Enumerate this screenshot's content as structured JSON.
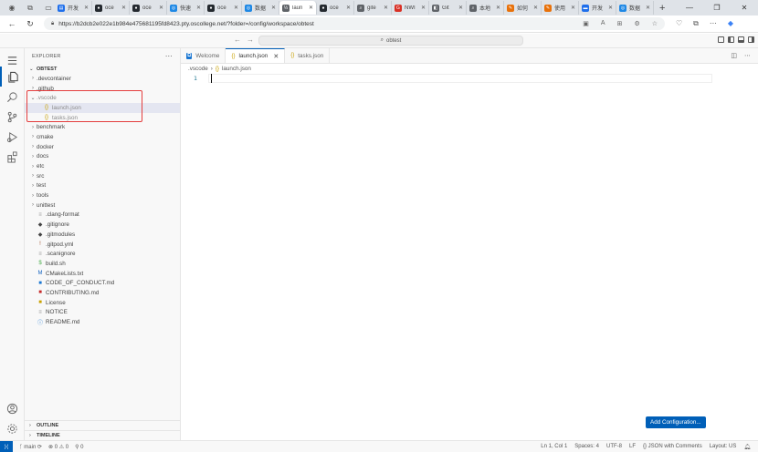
{
  "browser": {
    "tabs": [
      {
        "label": "开发",
        "color": "#1f6feb",
        "glyph": "▤"
      },
      {
        "label": "oce",
        "color": "#24292f",
        "glyph": "●"
      },
      {
        "label": "oce",
        "color": "#24292f",
        "glyph": "●"
      },
      {
        "label": "快速",
        "color": "#1e88e5",
        "glyph": "◎"
      },
      {
        "label": "oce",
        "color": "#24292f",
        "glyph": "●"
      },
      {
        "label": "数据",
        "color": "#1e88e5",
        "glyph": "◎"
      },
      {
        "label": "laun",
        "color": "#5f6368",
        "glyph": "⅓",
        "active": true
      },
      {
        "label": "oce",
        "color": "#24292f",
        "glyph": "●"
      },
      {
        "label": "gite",
        "color": "#5f6368",
        "glyph": "⌕"
      },
      {
        "label": "NWI",
        "color": "#d93025",
        "glyph": "G"
      },
      {
        "label": "Git",
        "color": "#5f6368",
        "glyph": "◧"
      },
      {
        "label": "本地",
        "color": "#5f6368",
        "glyph": "⌕"
      },
      {
        "label": "如何",
        "color": "#e8710a",
        "glyph": "✎"
      },
      {
        "label": "使用",
        "color": "#e8710a",
        "glyph": "✎"
      },
      {
        "label": "开发",
        "color": "#1f6feb",
        "glyph": "▬"
      },
      {
        "label": "数据",
        "color": "#1e88e5",
        "glyph": "◎"
      }
    ],
    "url": "https://b2dcb2e022e1b984e475681195fd8423.pty.oscollege.net/?folder=/config/workspace/obtest"
  },
  "titlebar": {
    "search": "obtest"
  },
  "explorer": {
    "header": "EXPLORER",
    "root": "OBTEST",
    "items": [
      {
        "label": ".devcontainer",
        "kind": "folder",
        "indent": 0
      },
      {
        "label": ".github",
        "kind": "folder",
        "indent": 0
      },
      {
        "label": ".vscode",
        "kind": "folder-open",
        "indent": 0
      },
      {
        "label": "launch.json",
        "kind": "json",
        "indent": 1,
        "selected": true
      },
      {
        "label": "tasks.json",
        "kind": "json",
        "indent": 1
      },
      {
        "label": "benchmark",
        "kind": "folder",
        "indent": 0
      },
      {
        "label": "cmake",
        "kind": "folder",
        "indent": 0
      },
      {
        "label": "docker",
        "kind": "folder",
        "indent": 0
      },
      {
        "label": "docs",
        "kind": "folder",
        "indent": 0
      },
      {
        "label": "etc",
        "kind": "folder",
        "indent": 0
      },
      {
        "label": "src",
        "kind": "folder",
        "indent": 0
      },
      {
        "label": "test",
        "kind": "folder",
        "indent": 0
      },
      {
        "label": "tools",
        "kind": "folder",
        "indent": 0
      },
      {
        "label": "unittest",
        "kind": "folder",
        "indent": 0
      },
      {
        "label": ".clang-format",
        "kind": "config",
        "indent": 0
      },
      {
        "label": ".gitignore",
        "kind": "git",
        "indent": 0
      },
      {
        "label": ".gitmodules",
        "kind": "git",
        "indent": 0
      },
      {
        "label": ".gitpod.yml",
        "kind": "yml",
        "indent": 0
      },
      {
        "label": ".scanignore",
        "kind": "text",
        "indent": 0
      },
      {
        "label": "build.sh",
        "kind": "shell",
        "indent": 0
      },
      {
        "label": "CMakeLists.txt",
        "kind": "cmake",
        "indent": 0
      },
      {
        "label": "CODE_OF_CONDUCT.md",
        "kind": "md-blue",
        "indent": 0
      },
      {
        "label": "CONTRIBUTING.md",
        "kind": "md-red",
        "indent": 0
      },
      {
        "label": "License",
        "kind": "license",
        "indent": 0
      },
      {
        "label": "NOTICE",
        "kind": "text",
        "indent": 0
      },
      {
        "label": "README.md",
        "kind": "info",
        "indent": 0
      }
    ],
    "outline": "OUTLINE",
    "timeline": "TIMELINE"
  },
  "editor": {
    "tabs": [
      {
        "label": "Welcome",
        "icon": "welcome"
      },
      {
        "label": "launch.json",
        "icon": "json",
        "active": true
      },
      {
        "label": "tasks.json",
        "icon": "json"
      }
    ],
    "breadcrumb": [
      ".vscode",
      "launch.json"
    ],
    "line_number": "1",
    "add_config": "Add Configuration..."
  },
  "status": {
    "branch": "main",
    "problems": "⊗ 0 ⚠ 0",
    "ports": "0",
    "cursor": "Ln 1, Col 1",
    "spaces": "Spaces: 4",
    "encoding": "UTF-8",
    "eol": "LF",
    "language": "{} JSON with Comments",
    "layout": "Layout: US"
  }
}
